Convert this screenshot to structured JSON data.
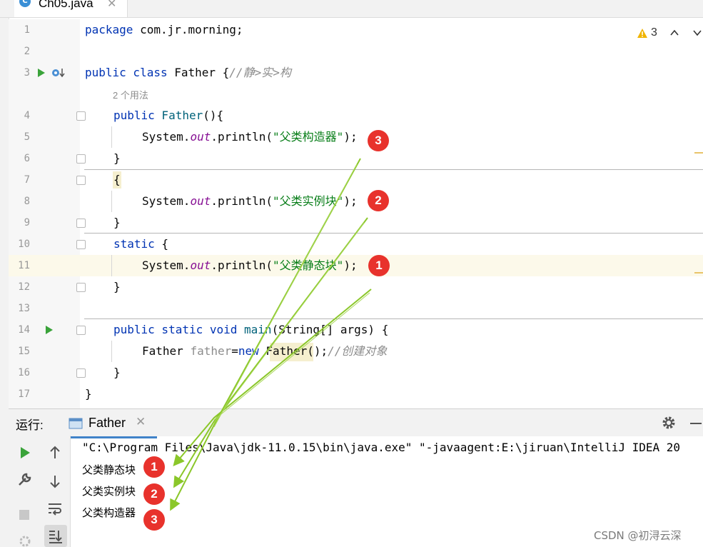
{
  "tab": {
    "icon": "C",
    "file_name": "Ch05.java",
    "close": "✕"
  },
  "inspection": {
    "count": "3",
    "up": "⌃",
    "down": "⌄"
  },
  "gutter": {
    "lines": [
      "1",
      "2",
      "3",
      "4",
      "5",
      "6",
      "7",
      "8",
      "9",
      "10",
      "11",
      "12",
      "13",
      "14",
      "15",
      "16",
      "17"
    ]
  },
  "code": {
    "l1_kw": "package",
    "l1_rest": " com.jr.morning;",
    "l3_kw1": "public",
    "l3_kw2": " class",
    "l3_name": " Father {",
    "l3_comment": "//静>实>构",
    "usages": "2 个用法",
    "l4_kw": "public",
    "l4_name": " Father",
    "l4_rest": "(){",
    "print_a": "System.",
    "print_out": "out",
    "print_b": ".println(",
    "str_ctor": "\"父类构造器\"",
    "str_inst": "\"父类实例块\"",
    "str_static": "\"父类静态块\"",
    "semi": ");",
    "brace_close": "}",
    "brace_open": "{",
    "l10_kw": "static",
    "l10_rest": " {",
    "l14_kw": "public static void",
    "l14_name": " main",
    "l14_rest": "(String[] args) {",
    "l15_a": "Father ",
    "l15_var": "father",
    "l15_eq": "=",
    "l15_new": "new",
    "l15_b": " ",
    "l15_cls": "Father",
    "l15_c": "();",
    "l15_comment": "//创建对象",
    "l17": "}"
  },
  "badges": {
    "b1": "1",
    "b2": "2",
    "b3": "3"
  },
  "run": {
    "label": "运行:",
    "tab": "Father",
    "close": "✕",
    "command": "\"C:\\Program Files\\Java\\jdk-11.0.15\\bin\\java.exe\" \"-javaagent:E:\\jiruan\\IntelliJ IDEA 20",
    "outputs": [
      "父类静态块",
      "父类实例块",
      "父类构造器"
    ]
  },
  "watermark": "CSDN @初浔云深",
  "colors": {
    "keyword": "#0033b3",
    "string": "#067d17",
    "badge": "#e8322c",
    "arrow": "#8bc72a"
  }
}
